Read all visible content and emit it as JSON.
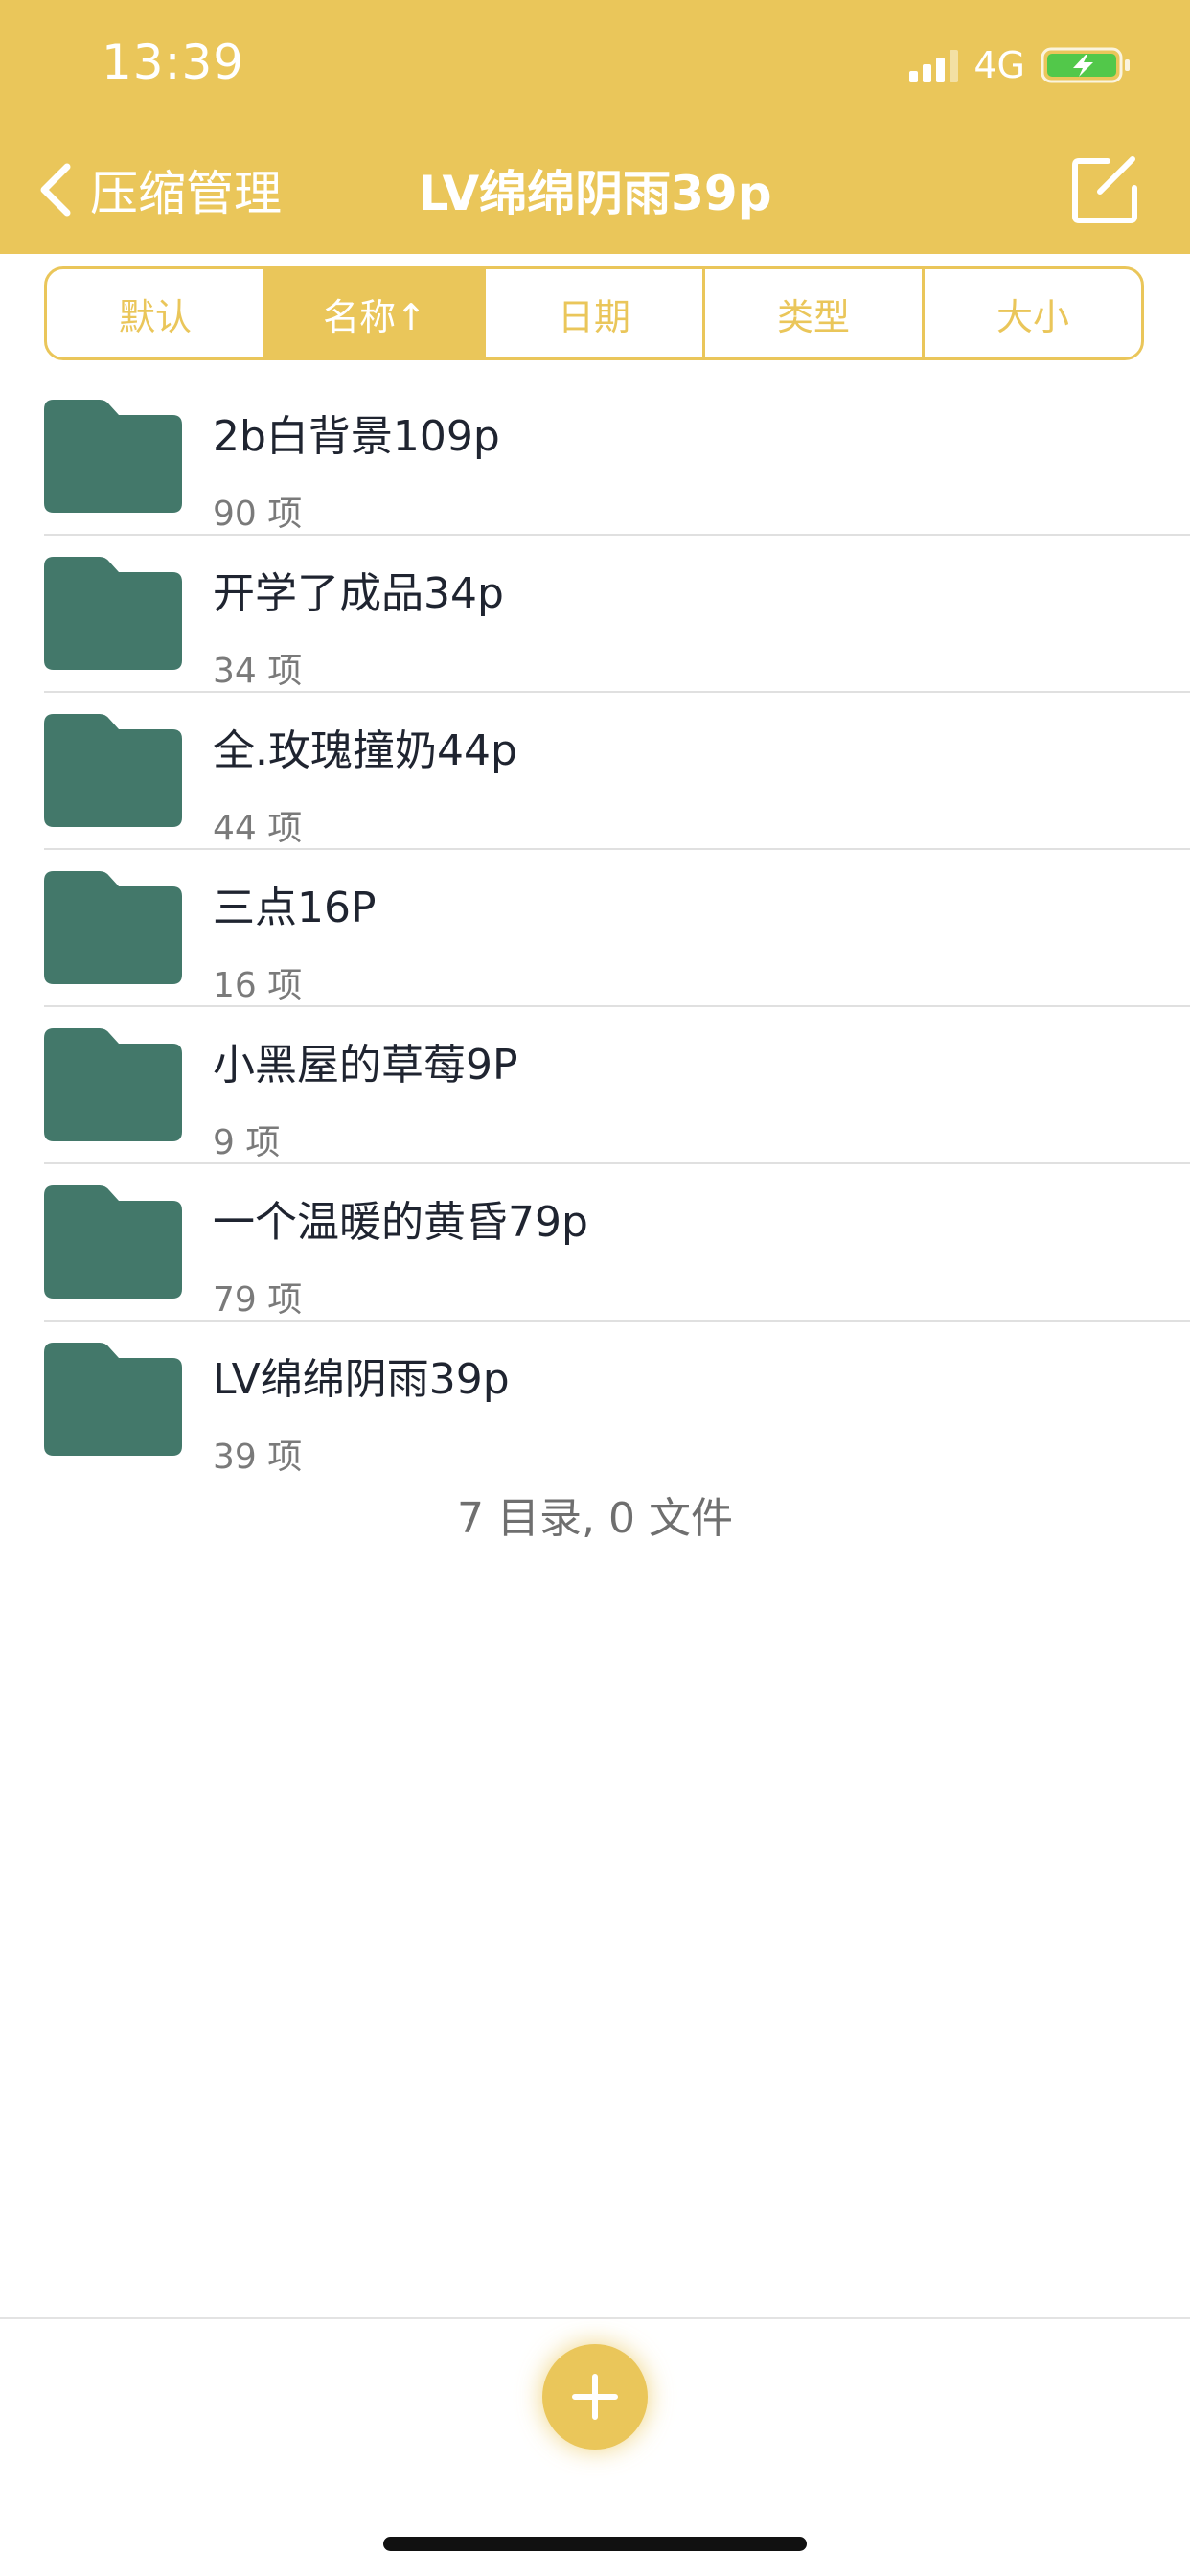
{
  "status_bar": {
    "time": "13:39",
    "network": "4G",
    "signal_bars_active": 3,
    "battery_charging": true,
    "icons": [
      "signal-icon",
      "battery-charging-icon"
    ]
  },
  "nav": {
    "back_label": "压缩管理",
    "title": "LV绵绵阴雨39p",
    "icons": [
      "chevron-left-icon",
      "edit-icon"
    ]
  },
  "sort_tabs": [
    {
      "label": "默认",
      "active": false
    },
    {
      "label": "名称↑",
      "active": true
    },
    {
      "label": "日期",
      "active": false
    },
    {
      "label": "类型",
      "active": false
    },
    {
      "label": "大小",
      "active": false
    }
  ],
  "folders": [
    {
      "name": "2b白背景109p",
      "count": "90  项"
    },
    {
      "name": "开学了成品34p",
      "count": "34  项"
    },
    {
      "name": "全.玫瑰撞奶44p",
      "count": "44  项"
    },
    {
      "name": "三点16P",
      "count": "16  项"
    },
    {
      "name": "小黑屋的草莓9P",
      "count": "9  项"
    },
    {
      "name": "一个温暖的黄昏79p",
      "count": "79  项"
    },
    {
      "name": "LV绵绵阴雨39p",
      "count": "39  项"
    }
  ],
  "summary": "7 目录, 0 文件",
  "colors": {
    "accent": "#EAC65A",
    "folder": "#43786A",
    "battery_fill": "#52C84A"
  },
  "fab": {
    "icon": "plus-icon"
  }
}
